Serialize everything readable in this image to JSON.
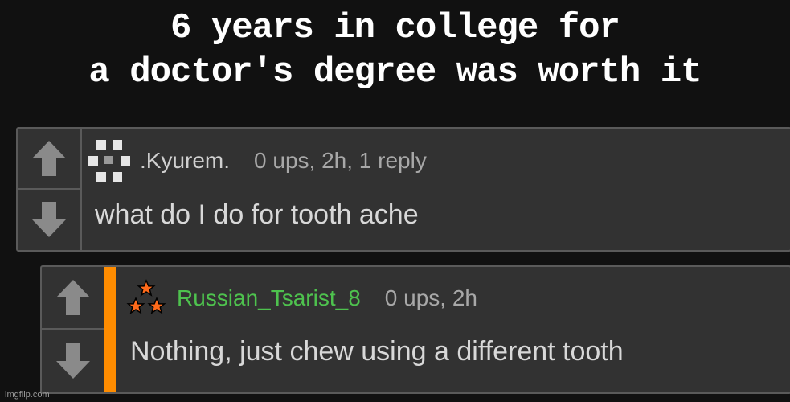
{
  "title": {
    "line1": "6 years in college for",
    "line2": "a doctor's degree was worth it"
  },
  "comments": [
    {
      "username": ".Kyurem.",
      "meta": "0 ups, 2h, 1 reply",
      "text": "what do I do for tooth ache",
      "avatar_icon": "pixel-pattern-icon",
      "username_color": "#d0d0d0"
    },
    {
      "username": "Russian_Tsarist_8",
      "meta": "0 ups, 2h",
      "text": "Nothing, just chew using a different tooth",
      "avatar_icon": "three-stars-icon",
      "username_color": "#4ec24e",
      "accent_color": "#ff8c00"
    }
  ],
  "watermark": "imgflip.com"
}
